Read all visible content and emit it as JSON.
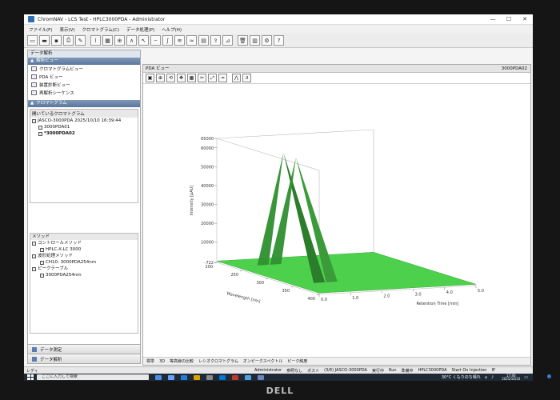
{
  "window": {
    "title": "ChromNAV - LCS Test - HPLC3000PDA - Administrator",
    "minimize": "—",
    "maximize": "☐",
    "close": "✕"
  },
  "menu": [
    "ファイル(F)",
    "表示(V)",
    "クロマトグラム(C)",
    "データ処理(P)",
    "ヘルプ(H)"
  ],
  "left": {
    "panel_label": "データ解析",
    "analysis_head": "解析ビュー",
    "analysis_items": [
      "クロマトグラムビュー",
      "PDA ビュー",
      "装置診断ビュー",
      "再解析シーケンス"
    ],
    "chrom_head": "クロマトグラム",
    "tree_head": "開いているクロマトグラム",
    "tree_items": [
      "JASCO-3000PDA 2025/10/10 16:39:44",
      "3000PDA01",
      "*3000PDA02"
    ],
    "method_head": "メソッド",
    "method_items": [
      "コントロールメソッド",
      "HPLC-X-LC 3000",
      "波形処理メソッド",
      "CH10: 3000PDA254nm",
      "ピークテーブル",
      "3000PDA254nm"
    ],
    "bottom_nav": [
      "データ測定",
      "データ解析"
    ]
  },
  "main": {
    "head_title": "PDA ビュー",
    "head_right": "3000PDA02",
    "footer_items": [
      "標準",
      "3D",
      "等高線の比較",
      "レシオクロマトグラム",
      "オンピークスペクトル",
      "ピーク純度"
    ]
  },
  "chart_data": {
    "type": "surface3d",
    "title": "",
    "zlabel": "Intensity [μAU]",
    "xlabel": "Retention Time [min]",
    "ylabel": "Wavelength [nm]",
    "z_ticks": [
      "65000",
      "60000",
      "50000",
      "40000",
      "30000",
      "20000",
      "10000",
      "-722"
    ],
    "x_ticks": [
      "0.0",
      "1.0",
      "2.0",
      "3.0",
      "4.0",
      "5.0"
    ],
    "y_ticks": [
      "200",
      "250",
      "300",
      "350",
      "400"
    ],
    "xlim": [
      0,
      5
    ],
    "ylim": [
      200,
      400
    ],
    "zlim": [
      -722,
      65000
    ],
    "peaks": [
      {
        "retention_time": 0.9,
        "max_intensity": 63000
      },
      {
        "retention_time": 1.3,
        "max_intensity": 60000
      }
    ],
    "surface_color": "#4dd14d",
    "peak_color": "#2f8f2f"
  },
  "statusbar": {
    "left": "レディ",
    "items": [
      "Administrator",
      "参照なし",
      "ポスト",
      "(3/6) JASCO-3000PDA",
      "実行中",
      "Run",
      "準備中",
      "HPLC3000PDA",
      "Start On Injection",
      "IP"
    ]
  },
  "taskbar": {
    "search_placeholder": "ここに入力して検索",
    "weather": "30°C くもりのち晴れ",
    "time": "17:46",
    "date": "2025/10/10"
  },
  "brand": "DELL"
}
